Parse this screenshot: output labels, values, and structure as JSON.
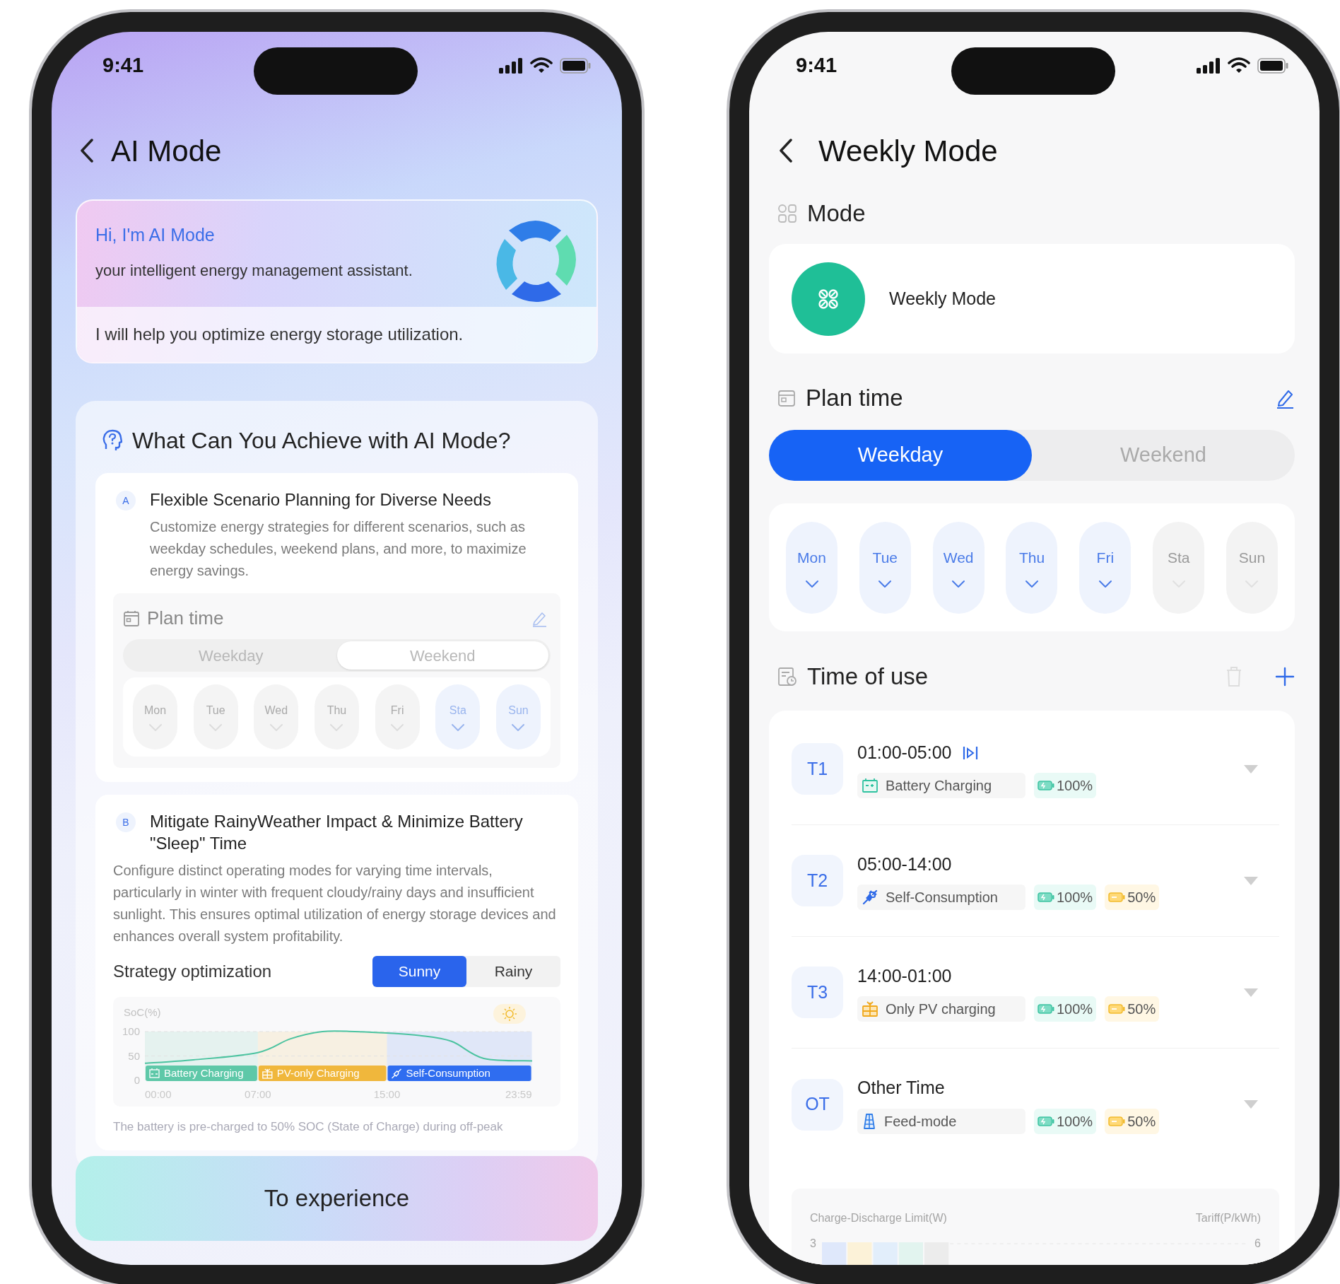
{
  "left": {
    "status_time": "9:41",
    "title": "AI Mode",
    "intro": {
      "greeting": "Hi, I'm AI Mode",
      "subtitle": "your intelligent energy management assistant.",
      "message": "I will help you optimize energy storage utilization."
    },
    "section_title": "What Can You Achieve with AI Mode?",
    "features": [
      {
        "kind": "plan",
        "letter": "A",
        "title": "Flexible Scenario Planning for Diverse Needs",
        "text": "Customize energy strategies for different scenarios, such as weekday schedules, weekend plans, and more, to maximize energy savings.",
        "preview": {
          "title": "Plan time",
          "tabs": [
            {
              "label": "Weekday",
              "selected": false
            },
            {
              "label": "Weekend",
              "selected": true
            }
          ],
          "days": [
            {
              "label": "Mon",
              "selected": false
            },
            {
              "label": "Tue",
              "selected": false
            },
            {
              "label": "Wed",
              "selected": false
            },
            {
              "label": "Thu",
              "selected": false
            },
            {
              "label": "Fri",
              "selected": false
            },
            {
              "label": "Sta",
              "selected": true
            },
            {
              "label": "Sun",
              "selected": true
            }
          ]
        }
      },
      {
        "kind": "strategy",
        "letter": "B",
        "title": "Mitigate RainyWeather Impact & Minimize Battery \"Sleep\" Time",
        "text": "Configure distinct operating modes for varying time intervals, particularly in winter with frequent cloudy/rainy days and insufficient sunlight. This ensures optimal utilization of energy storage devices and enhances overall system profitability.",
        "strategy": {
          "label": "Strategy optimization",
          "options": [
            {
              "label": "Sunny",
              "selected": true
            },
            {
              "label": "Rainy",
              "selected": false
            }
          ],
          "chart_data": {
            "type": "line",
            "ylabel": "SoC(%)",
            "x": [
              0,
              3,
              7,
              9,
              11,
              13,
              15,
              17,
              19,
              21,
              24
            ],
            "series": [
              {
                "color": "#4cc3a0",
                "values": [
                  35,
                  42,
                  57,
                  85,
                  100,
                  100,
                  97,
                  92,
                  80,
                  45,
                  40
                ]
              }
            ],
            "xlim": [
              0,
              24
            ],
            "ylim": [
              0,
              100
            ],
            "yticks": [
              0,
              50,
              100
            ],
            "xticks": [
              {
                "value": 0,
                "label": "00:00"
              },
              {
                "value": 7,
                "label": "07:00"
              },
              {
                "value": 15,
                "label": "15:00"
              },
              {
                "value": 23.98,
                "label": "23:59"
              }
            ],
            "bands": [
              {
                "axis": "x",
                "from": 0,
                "to": 7,
                "label": "Battery Charging",
                "color": "#5ec8a8"
              },
              {
                "axis": "x",
                "from": 7,
                "to": 15,
                "label": "PV-only Charging",
                "color": "#f0b73c"
              },
              {
                "axis": "x",
                "from": 15,
                "to": 23.98,
                "label": "Self-Consumption",
                "color": "#2f6df0"
              }
            ]
          }
        },
        "note": "The battery is pre-charged to 50% SOC (State of Charge) during off-peak"
      }
    ],
    "button": "To experience"
  },
  "right": {
    "status_time": "9:41",
    "title": "Weekly Mode",
    "mode": {
      "title": "Mode",
      "name": "Weekly Mode"
    },
    "plan": {
      "title": "Plan time",
      "tabs": [
        {
          "label": "Weekday",
          "selected": true
        },
        {
          "label": "Weekend",
          "selected": false
        }
      ],
      "days": [
        {
          "label": "Mon",
          "selected": true
        },
        {
          "label": "Tue",
          "selected": true
        },
        {
          "label": "Wed",
          "selected": true
        },
        {
          "label": "Thu",
          "selected": true
        },
        {
          "label": "Fri",
          "selected": true
        },
        {
          "label": "Sta",
          "selected": false
        },
        {
          "label": "Sun",
          "selected": false
        }
      ]
    },
    "time_of_use": {
      "title": "Time of use",
      "periods": [
        {
          "badge": "T1",
          "time": "01:00-05:00",
          "range_icon": true,
          "mode": {
            "kind": "battery",
            "label": "Battery Charging"
          },
          "levels": [
            {
              "kind": "charge",
              "text": "100%"
            }
          ]
        },
        {
          "badge": "T2",
          "time": "05:00-14:00",
          "range_icon": false,
          "mode": {
            "kind": "self",
            "label": "Self-Consumption"
          },
          "levels": [
            {
              "kind": "charge",
              "text": "100%"
            },
            {
              "kind": "discharge",
              "text": "50%"
            }
          ]
        },
        {
          "badge": "T3",
          "time": "14:00-01:00",
          "range_icon": false,
          "mode": {
            "kind": "pv",
            "label": "Only PV charging"
          },
          "levels": [
            {
              "kind": "charge",
              "text": "100%"
            },
            {
              "kind": "discharge",
              "text": "50%"
            }
          ]
        },
        {
          "badge": "OT",
          "time": "Other Time",
          "range_icon": false,
          "mode": {
            "kind": "feed",
            "label": "Feed-mode"
          },
          "levels": [
            {
              "kind": "charge",
              "text": "100%"
            },
            {
              "kind": "discharge",
              "text": "50%"
            }
          ]
        }
      ]
    },
    "limit_chart": {
      "left_title": "Charge-Discharge Limit(W)",
      "right_title": "Tariff(P/kWh)",
      "left_tick": "3",
      "right_tick": "6"
    }
  }
}
